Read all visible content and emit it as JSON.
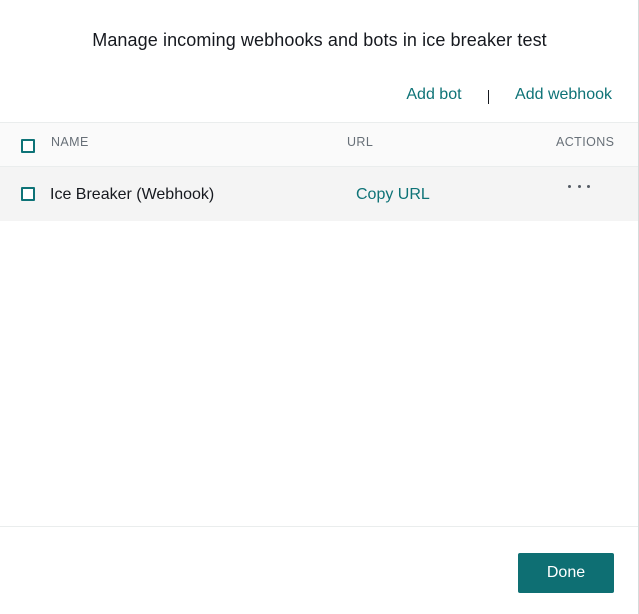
{
  "dialog": {
    "title": "Manage incoming webhooks and bots in ice breaker test"
  },
  "actions": {
    "add_bot": "Add bot",
    "add_webhook": "Add webhook"
  },
  "table": {
    "columns": [
      "NAME",
      "URL",
      "ACTIONS"
    ],
    "rows": [
      {
        "name": "Ice Breaker (Webhook)",
        "url_label": "Copy URL",
        "actions_icon": "more-horizontal-icon"
      }
    ]
  },
  "footer": {
    "done_label": "Done"
  },
  "colors": {
    "accent": "#0e7377",
    "button": "#0e6f73",
    "header_bg": "#fafafa",
    "row_bg": "#f4f4f4"
  }
}
